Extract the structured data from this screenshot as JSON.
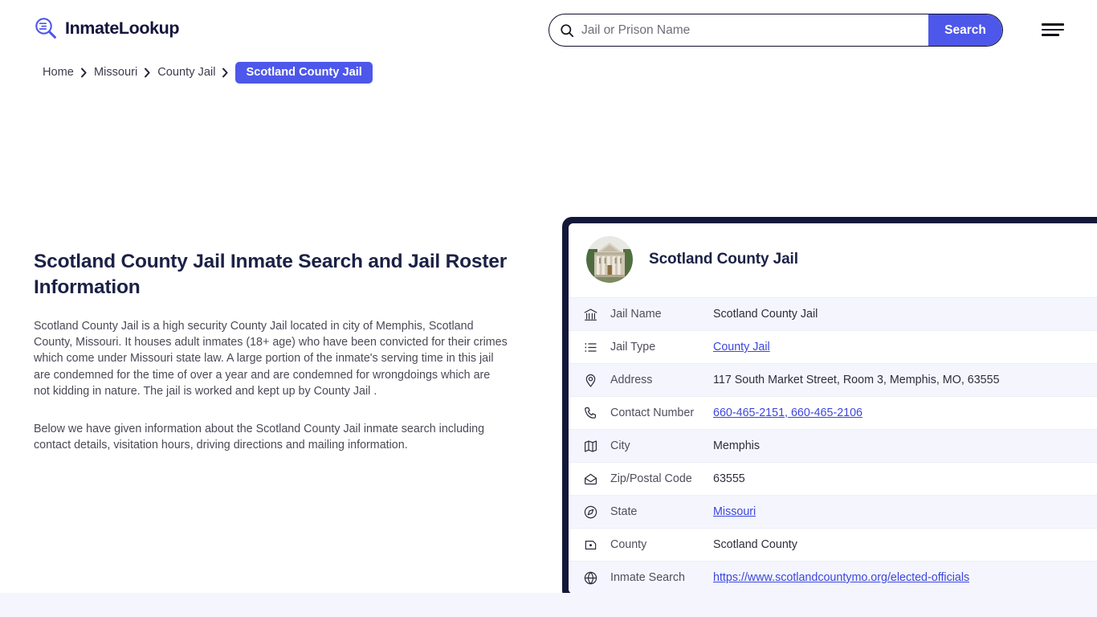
{
  "header": {
    "brand_name": "InmateLookup",
    "logo_icon": "magnifier-list-icon",
    "menu_icon": "hamburger-menu-icon",
    "accent_color": "#4d57ea",
    "dark_color": "#13183a"
  },
  "search": {
    "icon": "search-icon",
    "value": "",
    "placeholder": "Jail or Prison Name",
    "button_label": "Search"
  },
  "breadcrumb": {
    "separator_icon": "chevron-right-icon",
    "items": [
      {
        "label": "Home",
        "current": false
      },
      {
        "label": "Missouri",
        "current": false
      },
      {
        "label": "County Jail",
        "current": false
      },
      {
        "label": "Scotland County Jail",
        "current": true
      }
    ]
  },
  "article": {
    "title": "Scotland County Jail Inmate Search and Jail Roster Information",
    "paragraph_1": "Scotland County Jail is a high security County Jail located in city of Memphis, Scotland County, Missouri. It houses adult inmates (18+ age) who have been convicted for their crimes which come under Missouri state law. A large portion of the inmate's serving time in this jail are condemned for the time of over a year and are condemned for wrongdoings which are not kidding in nature. The jail is worked and kept up by County Jail .",
    "paragraph_2": "Below we have given information about the Scotland County Jail inmate search including contact details, visitation hours, driving directions and mailing information."
  },
  "card": {
    "avatar_icon": "courthouse-photo",
    "title": "Scotland County Jail",
    "rows": [
      {
        "icon": "bank-icon",
        "label": "Jail Name",
        "value": "Scotland County Jail",
        "link": false
      },
      {
        "icon": "list-icon",
        "label": "Jail Type",
        "value": "County Jail",
        "link": true
      },
      {
        "icon": "map-pin-icon",
        "label": "Address",
        "value": "117 South Market Street, Room 3, Memphis, MO, 63555",
        "link": false
      },
      {
        "icon": "phone-icon",
        "label": "Contact Number",
        "value": "660-465-2151, 660-465-2106",
        "link": true
      },
      {
        "icon": "map-icon",
        "label": "City",
        "value": "Memphis",
        "link": false
      },
      {
        "icon": "envelope-icon",
        "label": "Zip/Postal Code",
        "value": "63555",
        "link": false
      },
      {
        "icon": "compass-icon",
        "label": "State",
        "value": "Missouri",
        "link": true
      },
      {
        "icon": "county-map-icon",
        "label": "County",
        "value": "Scotland County",
        "link": false
      },
      {
        "icon": "globe-icon",
        "label": "Inmate Search",
        "value": "https://www.scotlandcountymo.org/elected-officials",
        "link": true
      }
    ]
  }
}
